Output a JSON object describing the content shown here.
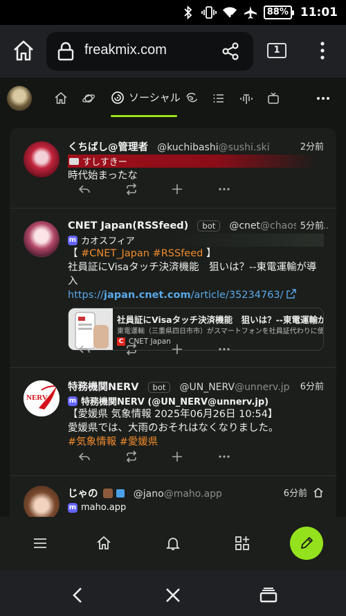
{
  "status_bar": {
    "icons": [
      "bluetooth-icon",
      "vibrate-icon",
      "wifi-icon",
      "airplane-icon"
    ],
    "battery": "88%",
    "time": "11:01"
  },
  "browser": {
    "url": "freakmix.com",
    "tab_count": "1"
  },
  "nav": {
    "active_tab": "ソーシャル",
    "accent": "#9ee21d",
    "tab_icons": [
      "home-icon",
      "planet-icon",
      "social-icon",
      "galaxy-icon",
      "list-icon",
      "antenna-icon",
      "tv-icon"
    ]
  },
  "notes": [
    {
      "display_name": "くちばし@管理者",
      "username": "@kuchibashi",
      "host": "@sushi.ski",
      "time": "2分前",
      "instance_name": "すしすきー",
      "text": "時代始まったな"
    },
    {
      "display_name": "CNET Japan(RSSfeed)",
      "bot_label": "bot",
      "username": "@cnet",
      "host": "@chaospher...",
      "time": "5分前",
      "instance_name": "カオスフィア",
      "text_prefix": "【",
      "tag1": "#CNET_Japan",
      "tag2": "#RSSfeed",
      "text_suffix": "】",
      "text_line2": "社員証にVisaタッチ決済機能　狙いは？--東電運輸が導入",
      "link_scheme": "https://",
      "link_host": "japan.cnet.com",
      "link_path": "/article/35234763/",
      "preview": {
        "title": "社員証にVisaタッチ決済機能　狙いは？--東電運輸が...",
        "description": "東電運輸（三重県四日市市）がスマートフォンを社員証代わりに使え...",
        "site": "CNET Japan",
        "site_mark": "C"
      }
    },
    {
      "display_name": "特務機関NERV",
      "bot_label": "bot",
      "username": "@UN_NERV",
      "host": "@unnerv.jp",
      "time": "6分前",
      "instance_name": "特務機関NERV (@UN_NERV@unnerv.jp)",
      "text_line1": "【愛媛県 気象情報 2025年06月26日 10:54】",
      "text_line2": "愛媛県では、大雨のおそれはなくなりました。",
      "tag1": "#気象情報",
      "tag2": "#愛媛県",
      "avatar_text": "NERV"
    },
    {
      "display_name": "じゃの",
      "username": "@jano",
      "host": "@maho.app",
      "time": "6分前",
      "instance_name": "maho.app"
    }
  ],
  "tag_color": "#f08a2c",
  "link_color": "#5aa8e8"
}
